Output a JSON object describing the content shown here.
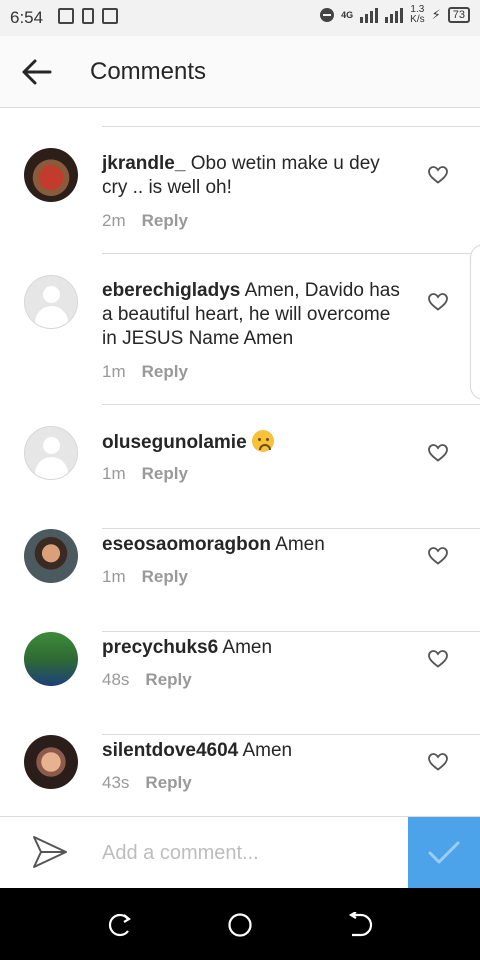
{
  "status_bar": {
    "time": "6:54",
    "network_type": "4G",
    "speed_value": "1.3",
    "speed_unit": "K/s",
    "battery": "73"
  },
  "header": {
    "title": "Comments",
    "back_icon": "arrow-left-icon"
  },
  "comments": [
    {
      "username": "jkrandle_",
      "text": "Obo wetin make u dey cry .. is well oh!",
      "time": "2m",
      "reply_label": "Reply",
      "avatar": "photo"
    },
    {
      "username": "eberechigladys",
      "text": "Amen, Davido has a beautiful heart, he will overcome in JESUS Name Amen",
      "time": "1m",
      "reply_label": "Reply",
      "avatar": "default"
    },
    {
      "username": "olusegunolamie",
      "text": "",
      "emoji": "crying-face-emoji",
      "time": "1m",
      "reply_label": "Reply",
      "avatar": "default"
    },
    {
      "username": "eseosaomoragbon",
      "text": "Amen",
      "time": "1m",
      "reply_label": "Reply",
      "avatar": "photo"
    },
    {
      "username": "precychuks6",
      "text": "Amen",
      "time": "48s",
      "reply_label": "Reply",
      "avatar": "photo"
    },
    {
      "username": "silentdove4604",
      "text": "Amen",
      "time": "43s",
      "reply_label": "Reply",
      "avatar": "photo"
    }
  ],
  "composer": {
    "placeholder": "Add a comment...",
    "value": "",
    "send_icon": "paper-plane-icon",
    "post_icon": "checkmark-icon",
    "post_color": "#4da3ea"
  },
  "nav_bar": {
    "icons": [
      "recents-icon",
      "home-icon",
      "back-icon"
    ]
  }
}
